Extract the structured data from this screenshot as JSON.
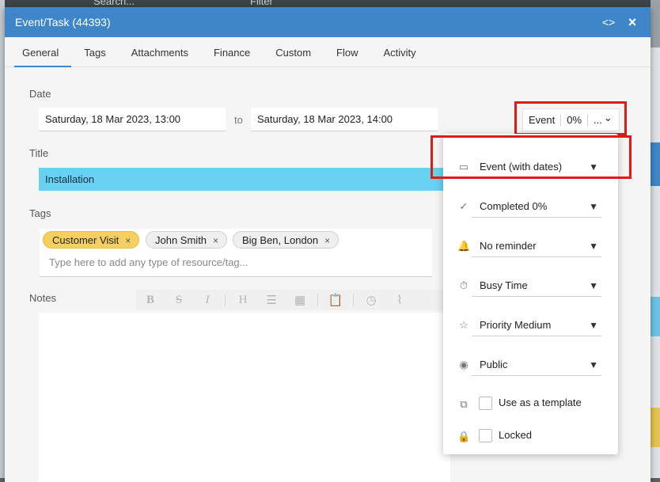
{
  "background": {
    "top_search": "Search...",
    "top_filter": "Filter"
  },
  "dialog": {
    "title": "Event/Task (44393)",
    "code_icon": "<>",
    "close_icon": "×",
    "accent": "#3f86c8"
  },
  "tabs": [
    {
      "label": "General",
      "active": true
    },
    {
      "label": "Tags"
    },
    {
      "label": "Attachments"
    },
    {
      "label": "Finance"
    },
    {
      "label": "Custom"
    },
    {
      "label": "Flow"
    },
    {
      "label": "Activity"
    }
  ],
  "date": {
    "label": "Date",
    "start": "Saturday, 18 Mar 2023, 13:00",
    "to_label": "to",
    "end": "Saturday, 18 Mar 2023, 14:00"
  },
  "title_field": {
    "label": "Title",
    "value": "Installation",
    "color": "#67d0f3"
  },
  "tags": {
    "label": "Tags",
    "chips": [
      {
        "label": "Customer Visit",
        "color": "#f5cf5f"
      },
      {
        "label": "John Smith"
      },
      {
        "label": "Big Ben, London"
      }
    ],
    "remove_icon": "×",
    "placeholder": "Type here to add any type of resource/tag..."
  },
  "notes": {
    "label": "Notes",
    "toolbar_icons": [
      "bold-icon",
      "strikethrough-icon",
      "italic-icon",
      "heading-icon",
      "list-icon",
      "grid-icon",
      "clipboard-icon",
      "clock-icon",
      "paperclip-icon"
    ]
  },
  "status_button": {
    "type": "Event",
    "progress": "0%",
    "more": "...",
    "chevron": "⌄"
  },
  "dropdown": {
    "items": [
      {
        "icon": "calendar-icon",
        "value": "Event (with dates)"
      },
      {
        "icon": "check-circle-icon",
        "value": "Completed 0%"
      },
      {
        "icon": "bell-icon",
        "value": "No reminder"
      },
      {
        "icon": "stopwatch-icon",
        "value": "Busy Time"
      },
      {
        "icon": "star-icon",
        "value": "Priority Medium"
      },
      {
        "icon": "eye-icon",
        "value": "Public"
      }
    ],
    "checkboxes": [
      {
        "icon": "copy-icon",
        "label": "Use as a template",
        "checked": false
      },
      {
        "icon": "lock-icon",
        "label": "Locked",
        "checked": false
      }
    ]
  }
}
